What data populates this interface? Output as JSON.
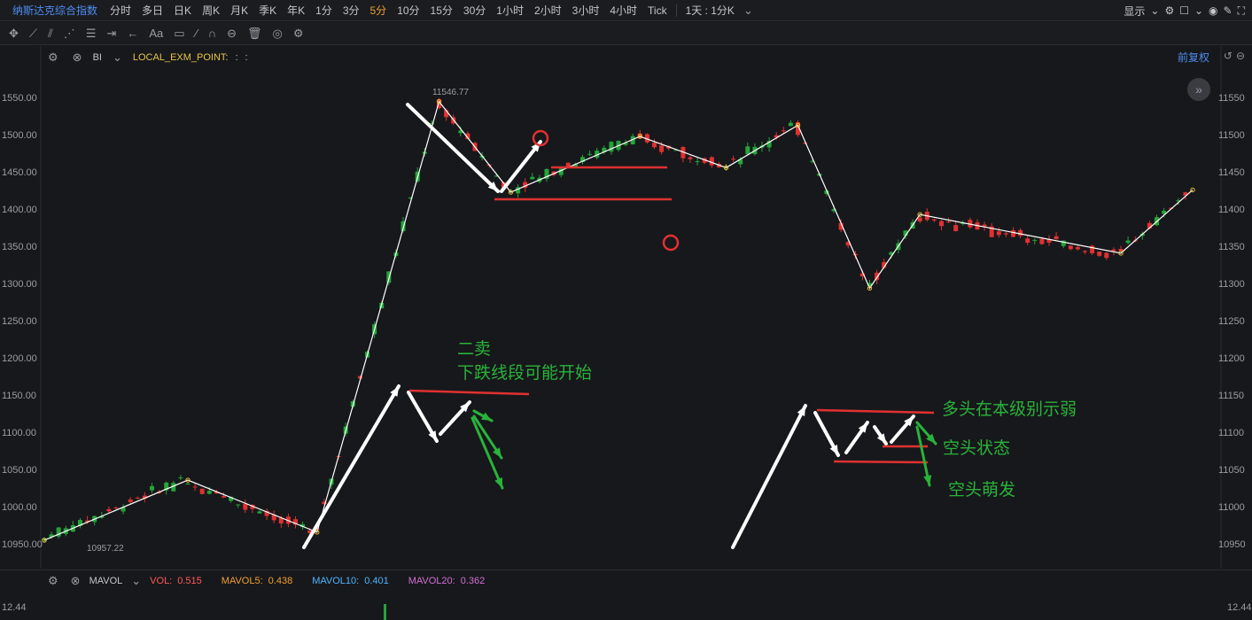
{
  "toolbar": {
    "symbol": "纳斯达克综合指数",
    "timeframes": [
      "分时",
      "多日",
      "日K",
      "周K",
      "月K",
      "季K",
      "年K",
      "1分",
      "3分",
      "5分",
      "10分",
      "15分",
      "30分",
      "1小时",
      "2小时",
      "3小时",
      "4小时",
      "Tick"
    ],
    "active_timeframe": "5分",
    "period": "1天 : 1分K",
    "display_label": "显示"
  },
  "indicator": {
    "name": "BI",
    "label": "LOCAL_EXM_POINT:",
    "sep1": ":",
    "sep2": ":"
  },
  "restore_label": "前复权",
  "y_axis": {
    "labels": [
      "1550.00",
      "1500.00",
      "1450.00",
      "1400.00",
      "1350.00",
      "1300.00",
      "1250.00",
      "1200.00",
      "1150.00",
      "1100.00",
      "1050.00",
      "1000.00",
      "10950.00"
    ],
    "right_labels": [
      "11550",
      "11500",
      "11450",
      "11400",
      "11350",
      "11300",
      "11250",
      "11200",
      "11150",
      "11100",
      "11050",
      "11000",
      "10950"
    ]
  },
  "point_labels": {
    "high": "11546.77",
    "low": "10957.22"
  },
  "annotations": {
    "sell2_line1": "二卖",
    "sell2_line2": "下跌线段可能开始",
    "bull_weak": "多头在本级别示弱",
    "bear_state": "空头状态",
    "bear_sprout": "空头萌发"
  },
  "volume": {
    "name": "MAVOL",
    "vol_label": "VOL:",
    "vol_value": "0.515",
    "ma5_label": "MAVOL5:",
    "ma5_value": "0.438",
    "ma10_label": "MAVOL10:",
    "ma10_value": "0.401",
    "ma20_label": "MAVOL20:",
    "ma20_value": "0.362",
    "axis_value": "12.44",
    "colors": {
      "vol": "#ff5a5a",
      "ma5": "#f0a030",
      "ma10": "#4db6ff",
      "ma20": "#d46fd6"
    }
  },
  "colors": {
    "up": "#23a53a",
    "down": "#e03131",
    "annotation": "#29b33a",
    "accent": "#4d8df0",
    "active": "#f0a030"
  },
  "chart_data": {
    "type": "line",
    "x": [
      0,
      20,
      38,
      55,
      65,
      83,
      95,
      105,
      115,
      122,
      150,
      160
    ],
    "series": [
      {
        "values": [
          10957.22,
          11038,
          10968,
          11546.77,
          11425,
          11500,
          11458,
          11515,
          11296,
          11395,
          11343,
          11428
        ]
      }
    ]
  }
}
